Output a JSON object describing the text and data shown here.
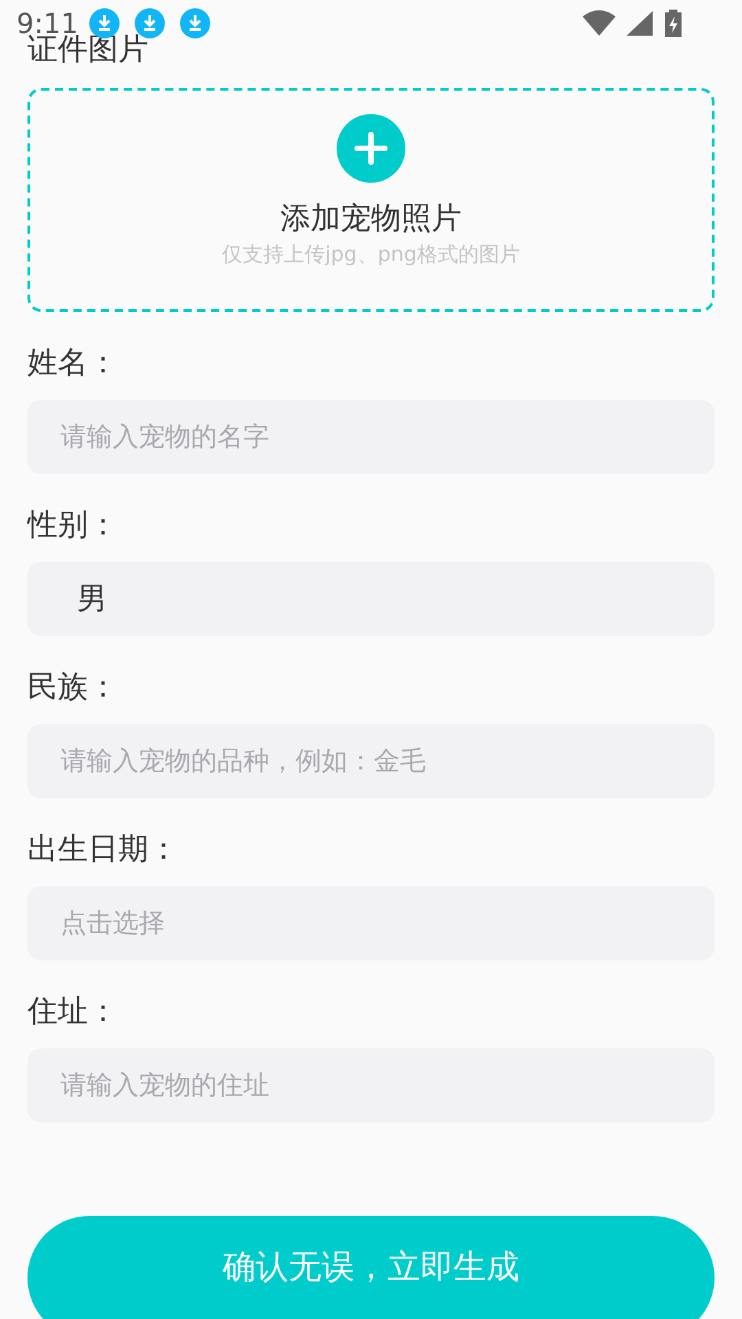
{
  "status_bar": {
    "time": "9:11",
    "notifications": [
      {
        "kind": "download"
      },
      {
        "kind": "download"
      },
      {
        "kind": "download"
      }
    ]
  },
  "upload": {
    "title": "证件图片",
    "label": "添加宠物照片",
    "hint": "仅支持上传jpg、png格式的图片"
  },
  "fields": [
    {
      "label": "姓名：",
      "placeholder": "请输入宠物的名字"
    },
    {
      "label": "性别：",
      "value": "男"
    },
    {
      "label": "民族：",
      "placeholder": "请输入宠物的品种，例如：金毛"
    },
    {
      "label": "出生日期：",
      "placeholder": "点击选择"
    },
    {
      "label": "住址：",
      "placeholder": "请输入宠物的住址"
    }
  ],
  "submit_button": "确认无误，立即生成"
}
